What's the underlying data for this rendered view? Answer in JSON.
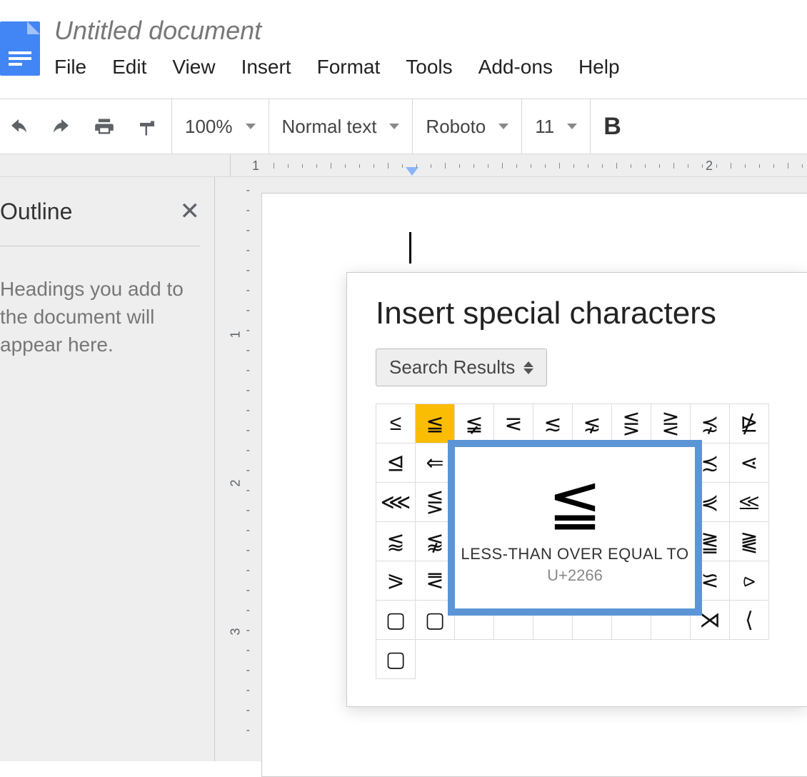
{
  "header": {
    "title": "Untitled document",
    "menu": [
      "File",
      "Edit",
      "View",
      "Insert",
      "Format",
      "Tools",
      "Add-ons",
      "Help"
    ]
  },
  "toolbar": {
    "zoom": "100%",
    "style": "Normal text",
    "font": "Roboto",
    "size": "11",
    "bold": "B"
  },
  "ruler": {
    "numbers": [
      "1",
      "2"
    ]
  },
  "outline": {
    "title": "Outline",
    "hint": "Headings you add to the document will appear here."
  },
  "dialog": {
    "title": "Insert special characters",
    "category": "Search Results",
    "grid": [
      [
        "≤",
        "≦",
        "≨",
        "⋜",
        "≲",
        "⋦",
        "⋚",
        "⋛",
        "⋨",
        "⋭"
      ],
      [
        "⊴",
        "⇐",
        "",
        "",
        "",
        "",
        "",
        "",
        "≾",
        "⋖"
      ],
      [
        "⋘",
        "⋚",
        "",
        "",
        "",
        "",
        "",
        "",
        "⋞",
        "⪣"
      ],
      [
        "⪅",
        "⪉",
        "",
        "",
        "",
        "",
        "",
        "",
        "⪒",
        "⪔"
      ],
      [
        "⪖",
        "⪙",
        "",
        "",
        "",
        "",
        "",
        "",
        "⪝",
        "⪧"
      ],
      [
        "▢",
        "▢",
        "",
        "",
        "",
        "",
        "",
        "",
        "⋊",
        "⟨"
      ]
    ],
    "selected": {
      "row": 0,
      "col": 1
    },
    "preview": {
      "glyph": "≦",
      "name": "LESS-THAN OVER EQUAL TO",
      "code": "U+2266"
    },
    "extra": "▢"
  }
}
